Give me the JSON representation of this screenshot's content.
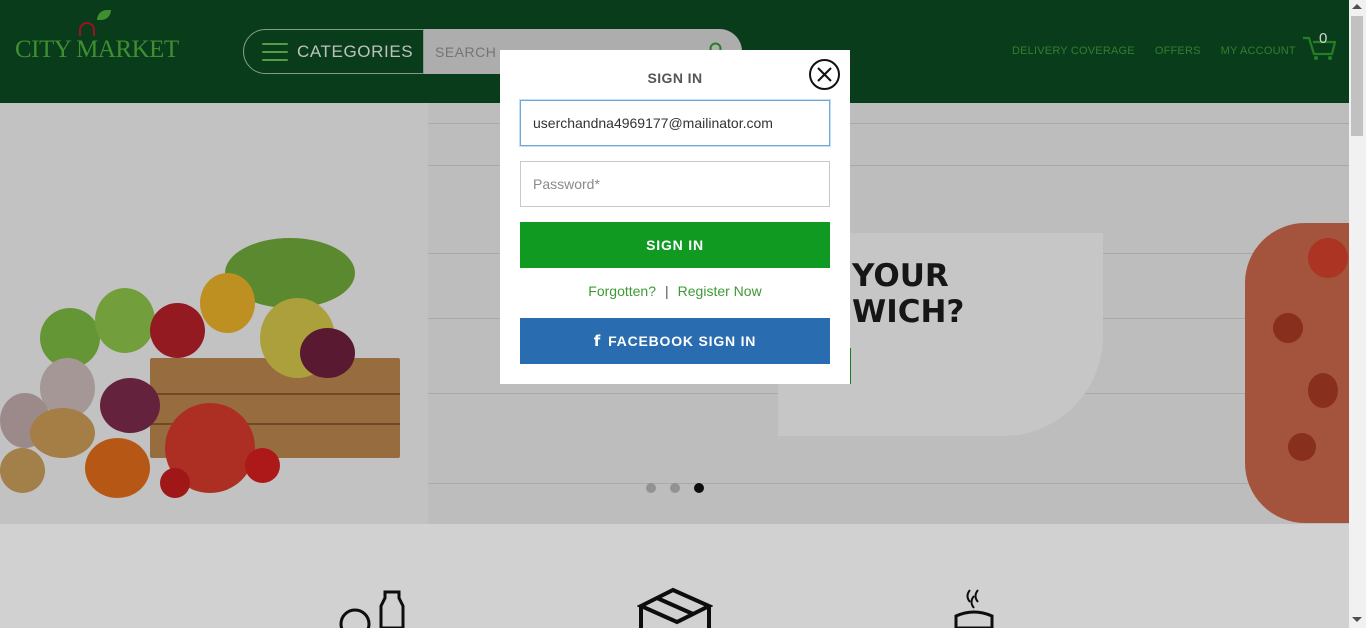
{
  "header": {
    "logo_text": "CITY MARKET",
    "categories_label": "CATEGORIES",
    "search": {
      "placeholder": "SEARCH"
    },
    "nav": [
      {
        "label": "DELIVERY COVERAGE"
      },
      {
        "label": "OFFERS"
      },
      {
        "label": "MY ACCOUNT"
      }
    ],
    "cart_count": "0"
  },
  "hero": {
    "headline_line1": "YOUR",
    "headline_line2": "WICH?",
    "carousel": {
      "slides": 3,
      "active_slide": 3
    }
  },
  "modal": {
    "title": "SIGN IN",
    "email_value": "userchandna4969177@mailinator.com",
    "password_placeholder": "Password*",
    "signin_label": "SIGN IN",
    "forgotten_label": "Forgotten?",
    "separator": "|",
    "register_label": "Register Now",
    "facebook_label": "FACEBOOK SIGN IN",
    "facebook_icon_glyph": "f"
  },
  "colors": {
    "header_bg": "#0c4a21",
    "brand_green": "#4fae3e",
    "signin_button": "#109a22",
    "facebook_button": "#2a6cb0",
    "link_green": "#3e9a35"
  },
  "icons": {
    "close": "close-circle-icon",
    "search": "search-icon",
    "cart": "shopping-cart-icon",
    "menu": "hamburger-menu-icon",
    "facebook": "facebook-icon"
  }
}
